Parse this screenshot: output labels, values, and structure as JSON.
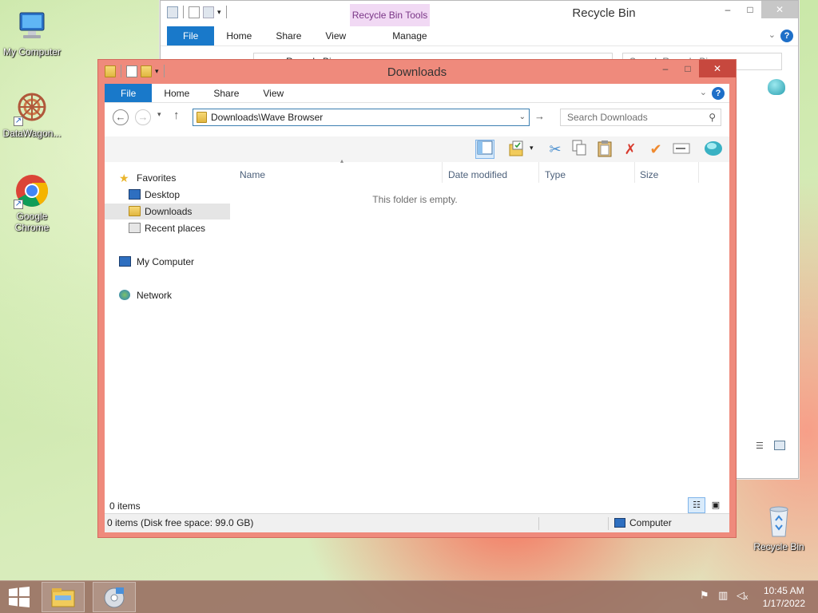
{
  "desktop": {
    "icons": [
      {
        "label": "My Computer"
      },
      {
        "label": "DataWagon..."
      },
      {
        "label": "Google Chrome"
      },
      {
        "label": "Recycle Bin"
      }
    ]
  },
  "recycle_window": {
    "title": "Recycle Bin",
    "contextual_tab_group": "Recycle Bin Tools",
    "tabs": [
      "File",
      "Home",
      "Share",
      "View",
      "Manage"
    ],
    "address": "Recycle Bin",
    "search_placeholder": "Search Recycle Bin"
  },
  "downloads_window": {
    "title": "Downloads",
    "tabs": [
      "File",
      "Home",
      "Share",
      "View"
    ],
    "address": "Downloads\\Wave Browser",
    "search_placeholder": "Search Downloads",
    "nav": {
      "favorites": "Favorites",
      "desktop": "Desktop",
      "downloads": "Downloads",
      "recent": "Recent places",
      "my_computer": "My Computer",
      "network": "Network"
    },
    "columns": [
      "Name",
      "Date modified",
      "Type",
      "Size"
    ],
    "empty_message": "This folder is empty.",
    "item_count": "0 items",
    "status_left": "0 items (Disk free space: 99.0 GB)",
    "status_right": "Computer"
  },
  "taskbar": {
    "time": "10:45 AM",
    "date": "1/17/2022"
  },
  "colors": {
    "active_frame": "#ef8a7c",
    "ribbon_file_tab": "#1979ca",
    "tools_tab": "#f1d9f4"
  }
}
